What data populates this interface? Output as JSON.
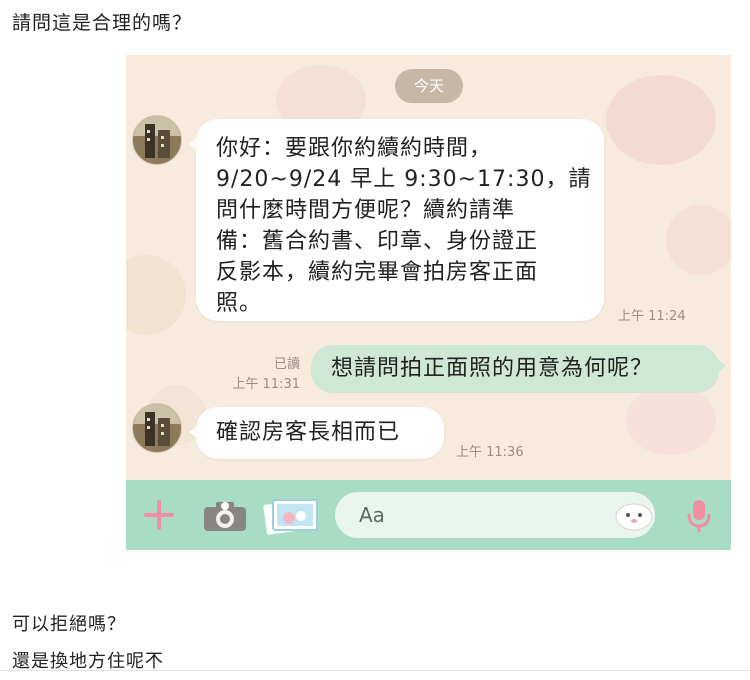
{
  "post": {
    "question": "請問這是合理的嗎？",
    "line1": "可以拒絕嗎？",
    "line2": "還是換地方住呢𣎴"
  },
  "chat": {
    "date_chip": "今天",
    "messages": [
      {
        "from": "landlord",
        "text": "你好：要跟你約續約時間，\n9/20~9/24 早上 9:30~17:30，請\n問什麼時間方便呢？續約請準\n備：舊合約書、印章、身份證正\n反影本，續約完畢會拍房客正面\n照。",
        "time": "上午 11:24"
      },
      {
        "from": "me",
        "text": "想請問拍正面照的用意為何呢？",
        "read": "已讀",
        "time": "上午 11:31"
      },
      {
        "from": "landlord",
        "text": "確認房客長相而已",
        "time": "上午 11:36"
      }
    ],
    "input_placeholder": "Aa"
  },
  "colors": {
    "wallpaper": "#f6ebdd",
    "incoming_bubble": "#ffffff",
    "outgoing_bubble": "#cfe8d6",
    "input_bar": "#a9dcc4",
    "accent_pink": "#f08ea4"
  },
  "icons": [
    "plus-icon",
    "camera-icon",
    "gallery-icon",
    "sticker-icon",
    "microphone-icon"
  ]
}
